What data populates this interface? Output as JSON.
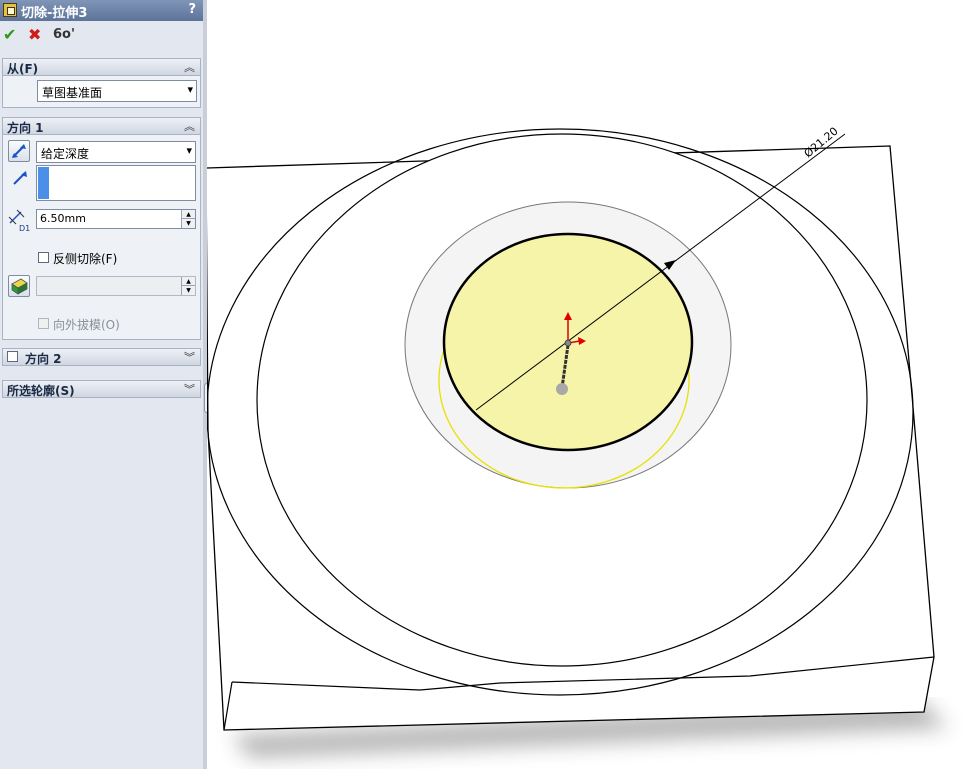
{
  "feature": {
    "title": "切除-拉伸3",
    "help_label": "?"
  },
  "toolbar": {
    "ok_glyph": "✔",
    "cancel_glyph": "✖",
    "preview_glyph": "6o'"
  },
  "from_section": {
    "label": "从(F)",
    "start_condition": "草图基准面"
  },
  "direction1": {
    "label": "方向 1",
    "end_condition": "给定深度",
    "depth_value": "6.50mm",
    "depth_icon_label": "D1",
    "flip_side_label": "反侧切除(F)",
    "flip_side_checked": false,
    "draft_label": "向外拔模(O)",
    "draft_checked": false
  },
  "direction2": {
    "label": "方向 2",
    "checked": false
  },
  "contours_section": {
    "label": "所选轮廓(S)"
  },
  "graphics": {
    "dimension_text": "Ø21.20",
    "preview_fill": "#f6f4a8",
    "preview_edge": "#e8e000",
    "axis_x_color": "#e00000",
    "axis_y_color": "#e00000"
  }
}
